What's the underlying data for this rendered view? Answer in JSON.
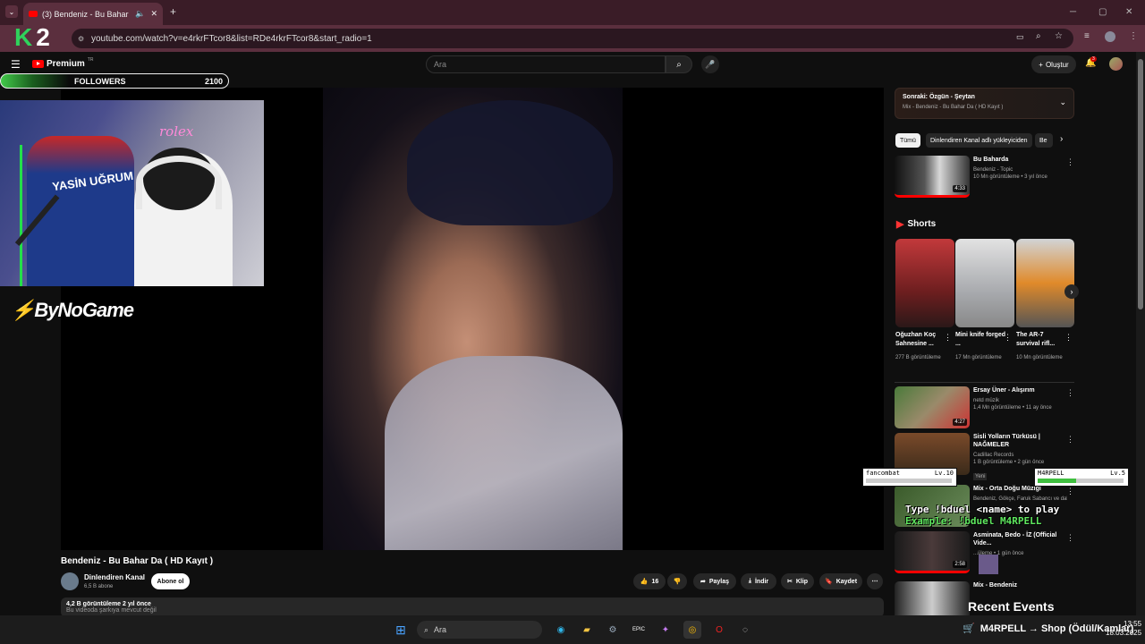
{
  "browser": {
    "tab_title": "(3) Bendeniz - Bu Bahar Da",
    "url": "youtube.com/watch?v=e4rkrFTcor8&list=RDe4rkrFTcor8&start_radio=1"
  },
  "youtube": {
    "logo": "Premium",
    "logo_region": "TR",
    "search_placeholder": "Ara",
    "create_label": "Oluştur",
    "notification_count": "3"
  },
  "video": {
    "title": "Bendeniz - Bu Bahar Da ( HD Kayıt )",
    "channel": "Dinlendiren Kanal",
    "subscribers": "6,5 B abone",
    "subscribe_label": "Abone ol",
    "likes": "16",
    "share_label": "Paylaş",
    "download_label": "İndir",
    "clip_label": "Klip",
    "save_label": "Kaydet",
    "views_line": "4,2 B görüntüleme  2 yıl önce",
    "description_preview": "Bu videoda şarkıya mevcut değil"
  },
  "sidebar": {
    "next_title": "Sonraki: Özgün - Şeytan",
    "next_subtitle": "Mix - Bendeniz - Bu Bahar Da ( HD Kayıt )",
    "chips": [
      "Tümü",
      "Dinlendiren Kanal adlı yükleyiciden",
      "Be"
    ],
    "top_video": {
      "title": "Bu Baharda",
      "channel": "Bendeniz - Topic",
      "meta": "10 Mn görüntüleme • 3 yıl önce",
      "duration": "4:33"
    },
    "shorts_heading": "Shorts",
    "shorts": [
      {
        "title": "Oğuzhan Koç Sahnesine ...",
        "views": "277 B görüntüleme"
      },
      {
        "title": "Mini knife forged ...",
        "views": "17 Mn görüntüleme"
      },
      {
        "title": "The AR-7 survival rifl...",
        "views": "10 Mn görüntüleme"
      }
    ],
    "videos": [
      {
        "title": "Ersay Üner - Alışırım",
        "channel": "netd müzik",
        "meta": "1,4 Mn görüntüleme • 11 ay önce",
        "duration": "4:27"
      },
      {
        "title": "Sisli Yolların Türküsü | NAĞMELER",
        "channel": "Cadillac Records",
        "meta": "1 B görüntüleme • 2 gün önce",
        "badge": "Yeni"
      },
      {
        "title": "Mix - Orta Doğu Müziği",
        "channel": "Bendeniz, Gökçe, Faruk Sabancı ve daha ..."
      },
      {
        "title": "Asminata, Bedo - İZ (Official Vide...",
        "meta": "...üleme • 1 gün önce",
        "duration": "2:58"
      },
      {
        "title": "Mix - Bendeniz"
      }
    ]
  },
  "overlay": {
    "followers_label": "FOLLOWERS",
    "followers_count": "2100",
    "neon_sign": "rolex",
    "chair_text": "YASİN UĞRUM",
    "sponsor": "ByNoGame",
    "k2_logo": "2",
    "player1": {
      "name": "fancombat",
      "level": "Lv.10",
      "hp_fraction": 0.0
    },
    "player2": {
      "name": "M4RPELL",
      "level": "Lv.5",
      "hp_fraction": 0.45
    },
    "duel_line1": "Type !bduel <name> to play",
    "duel_line2": "Example: !bduel M4RPELL",
    "recent_events": "Recent Events",
    "ticker": "M4RPELL → Shop (Ödül/Kamlar)"
  },
  "taskbar": {
    "search_placeholder": "Ara",
    "time": "13:55",
    "date": "18.03.2025"
  }
}
